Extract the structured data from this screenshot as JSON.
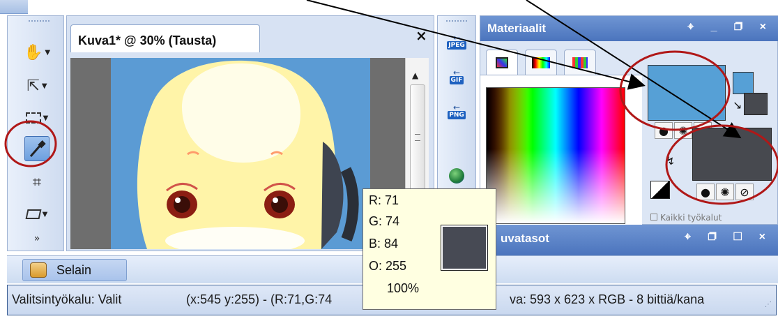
{
  "document": {
    "tab_title": "Kuva1* @  30% (Tausta)",
    "close_label": "×"
  },
  "export": {
    "formats": [
      "JPEG",
      "GIF",
      "PNG"
    ]
  },
  "materials": {
    "title": "Materiaalit",
    "window_controls": "⌖ _ ❐ ×",
    "foreground_color": "#56a0d6",
    "background_color": "#47494f",
    "partial_label": "Kaikki työkalut"
  },
  "layers": {
    "title": "uvatasot",
    "window_controls": "⌖ ❐ ☐ ×"
  },
  "browser": {
    "tab_label": "Selain"
  },
  "status": {
    "tool": "Valitsintyökalu: Valit",
    "coords": "(x:545 y:255) - (R:71,G:74",
    "image": "va:  593 x 623 x RGB - 8 bittiä/kana"
  },
  "picker_tooltip": {
    "r": "R: 71",
    "g": "G: 74",
    "b": "B: 84",
    "o": "O: 255",
    "percent": "100%",
    "swatch_color": "#474a54"
  },
  "annotations": {
    "stroke_color": "#b01818"
  }
}
